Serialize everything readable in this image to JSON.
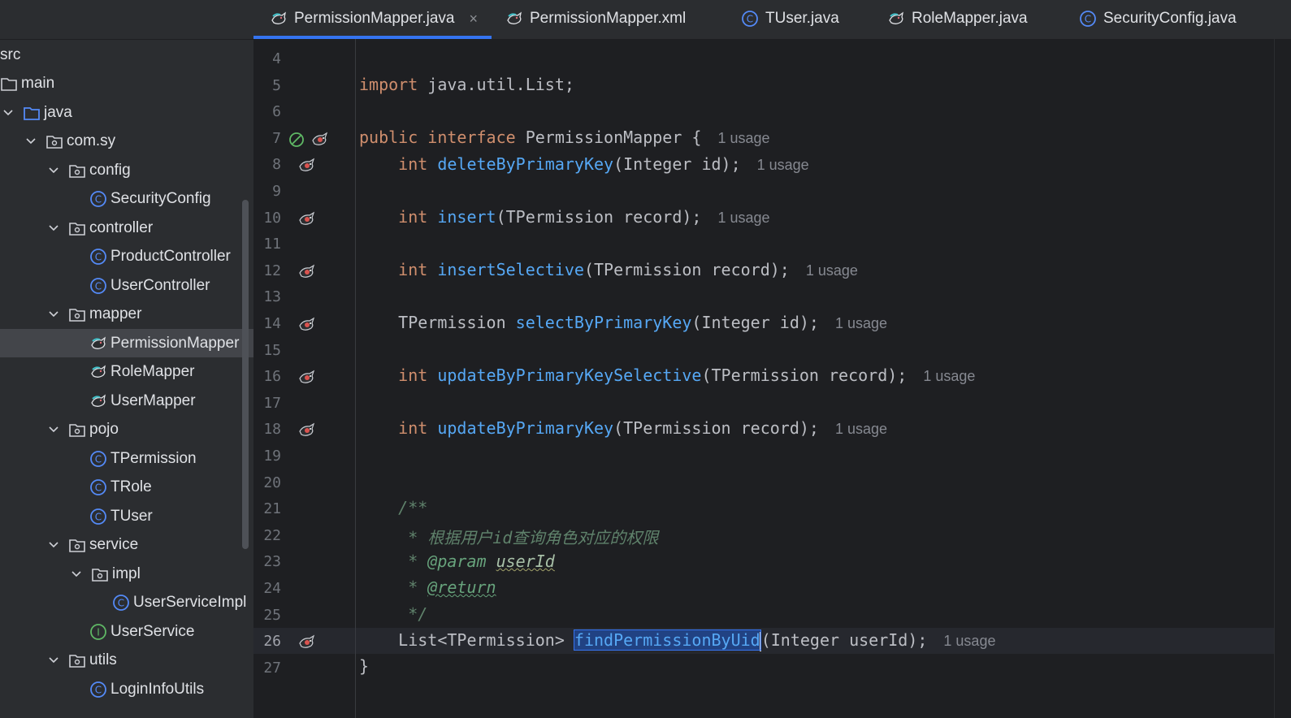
{
  "sidebar": {
    "tree": [
      {
        "label": "src",
        "icon": "none",
        "expanded": null,
        "depth": 0
      },
      {
        "label": "main",
        "icon": "folder-icon",
        "expanded": null,
        "depth": 0
      },
      {
        "label": "java",
        "icon": "source-folder-icon",
        "expanded": true,
        "depth": 0
      },
      {
        "label": "com.sy",
        "icon": "package-icon",
        "expanded": true,
        "depth": 1
      },
      {
        "label": "config",
        "icon": "package-icon",
        "expanded": true,
        "depth": 2
      },
      {
        "label": "SecurityConfig",
        "icon": "class-icon",
        "expanded": null,
        "depth": 3
      },
      {
        "label": "controller",
        "icon": "package-icon",
        "expanded": true,
        "depth": 2
      },
      {
        "label": "ProductController",
        "icon": "class-icon",
        "expanded": null,
        "depth": 3
      },
      {
        "label": "UserController",
        "icon": "class-icon",
        "expanded": null,
        "depth": 3
      },
      {
        "label": "mapper",
        "icon": "package-icon",
        "expanded": true,
        "depth": 2
      },
      {
        "label": "PermissionMapper",
        "icon": "mybatis-mapper-icon",
        "expanded": null,
        "depth": 3,
        "selected": true
      },
      {
        "label": "RoleMapper",
        "icon": "mybatis-mapper-icon",
        "expanded": null,
        "depth": 3
      },
      {
        "label": "UserMapper",
        "icon": "mybatis-mapper-icon",
        "expanded": null,
        "depth": 3
      },
      {
        "label": "pojo",
        "icon": "package-icon",
        "expanded": true,
        "depth": 2
      },
      {
        "label": "TPermission",
        "icon": "class-icon",
        "expanded": null,
        "depth": 3
      },
      {
        "label": "TRole",
        "icon": "class-icon",
        "expanded": null,
        "depth": 3
      },
      {
        "label": "TUser",
        "icon": "class-icon",
        "expanded": null,
        "depth": 3
      },
      {
        "label": "service",
        "icon": "package-icon",
        "expanded": true,
        "depth": 2
      },
      {
        "label": "impl",
        "icon": "package-icon",
        "expanded": true,
        "depth": 3
      },
      {
        "label": "UserServiceImpl",
        "icon": "class-icon",
        "expanded": null,
        "depth": 4
      },
      {
        "label": "UserService",
        "icon": "interface-icon",
        "expanded": null,
        "depth": 3
      },
      {
        "label": "utils",
        "icon": "package-icon",
        "expanded": true,
        "depth": 2
      },
      {
        "label": "LoginInfoUtils",
        "icon": "class-icon",
        "expanded": null,
        "depth": 3
      }
    ]
  },
  "tabs": [
    {
      "label": "PermissionMapper.java",
      "icon": "mybatis-mapper-icon",
      "active": true,
      "close": "×"
    },
    {
      "label": "PermissionMapper.xml",
      "icon": "mybatis-mapper-icon",
      "active": false
    },
    {
      "label": "TUser.java",
      "icon": "class-icon",
      "active": false
    },
    {
      "label": "RoleMapper.java",
      "icon": "mybatis-mapper-icon",
      "active": false
    },
    {
      "label": "SecurityConfig.java",
      "icon": "class-icon",
      "active": false
    }
  ],
  "editor": {
    "line_numbers": [
      "4",
      "5",
      "6",
      "7",
      "8",
      "9",
      "10",
      "11",
      "12",
      "13",
      "14",
      "15",
      "16",
      "17",
      "18",
      "19",
      "20",
      "21",
      "22",
      "23",
      "24",
      "25",
      "26",
      "27"
    ],
    "current_line": "26",
    "usage_hint": "1 usage",
    "lines": {
      "l5_kw": "import",
      "l5_rest": " java.util.List;",
      "l7_kw1": "public",
      "l7_kw2": "interface",
      "l7_rest": " PermissionMapper {",
      "l8_type": "int",
      "l8_fn": "deleteByPrimaryKey",
      "l8_args": "(Integer id);",
      "l10_type": "int",
      "l10_fn": "insert",
      "l10_args": "(TPermission record);",
      "l12_type": "int",
      "l12_fn": "insertSelective",
      "l12_args": "(TPermission record);",
      "l14_type": "TPermission",
      "l14_fn": "selectByPrimaryKey",
      "l14_args": "(Integer id);",
      "l16_type": "int",
      "l16_fn": "updateByPrimaryKeySelective",
      "l16_args": "(TPermission record);",
      "l18_type": "int",
      "l18_fn": "updateByPrimaryKey",
      "l18_args": "(TPermission record);",
      "l21": "/**",
      "l22": " * 根据用户id查询角色对应的权限",
      "l23_star": " * ",
      "l23_tag": "@param",
      "l23_param": "userId",
      "l24_star": " * ",
      "l24_tag": "@return",
      "l25": " */",
      "l26_type": "List<TPermission>",
      "l26_fn": "findPermissionByUid",
      "l26_args": "(Integer userId);",
      "l27": "}"
    }
  },
  "colors": {
    "accent": "#3574f0",
    "keyword": "#cf8e6d",
    "function": "#56a8f5",
    "comment": "#5f826b"
  }
}
